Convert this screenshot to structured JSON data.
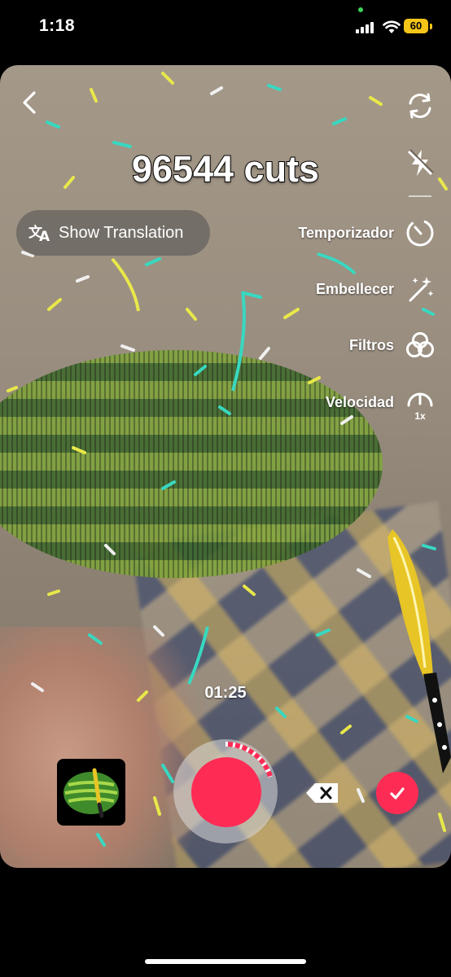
{
  "status_bar": {
    "time": "1:18",
    "battery": "60"
  },
  "camera": {
    "overlay_title": "96544 cuts",
    "show_translation": {
      "label": "Show Translation",
      "icon": "translate-icon"
    },
    "tools": [
      {
        "label": "",
        "icon": "flip-camera-icon"
      },
      {
        "label": "",
        "icon": "flash-off-icon"
      },
      {
        "label": "Temporizador",
        "icon": "timer-icon"
      },
      {
        "label": "Embellecer",
        "icon": "magic-wand-icon"
      },
      {
        "label": "Filtros",
        "icon": "filters-icon"
      },
      {
        "label": "Velocidad",
        "icon": "speed-icon",
        "badge": "1x"
      }
    ],
    "recording_time": "01:25",
    "record_progress": 0.2
  },
  "colors": {
    "accent": "#fe2c55",
    "battery": "#f5c518"
  }
}
